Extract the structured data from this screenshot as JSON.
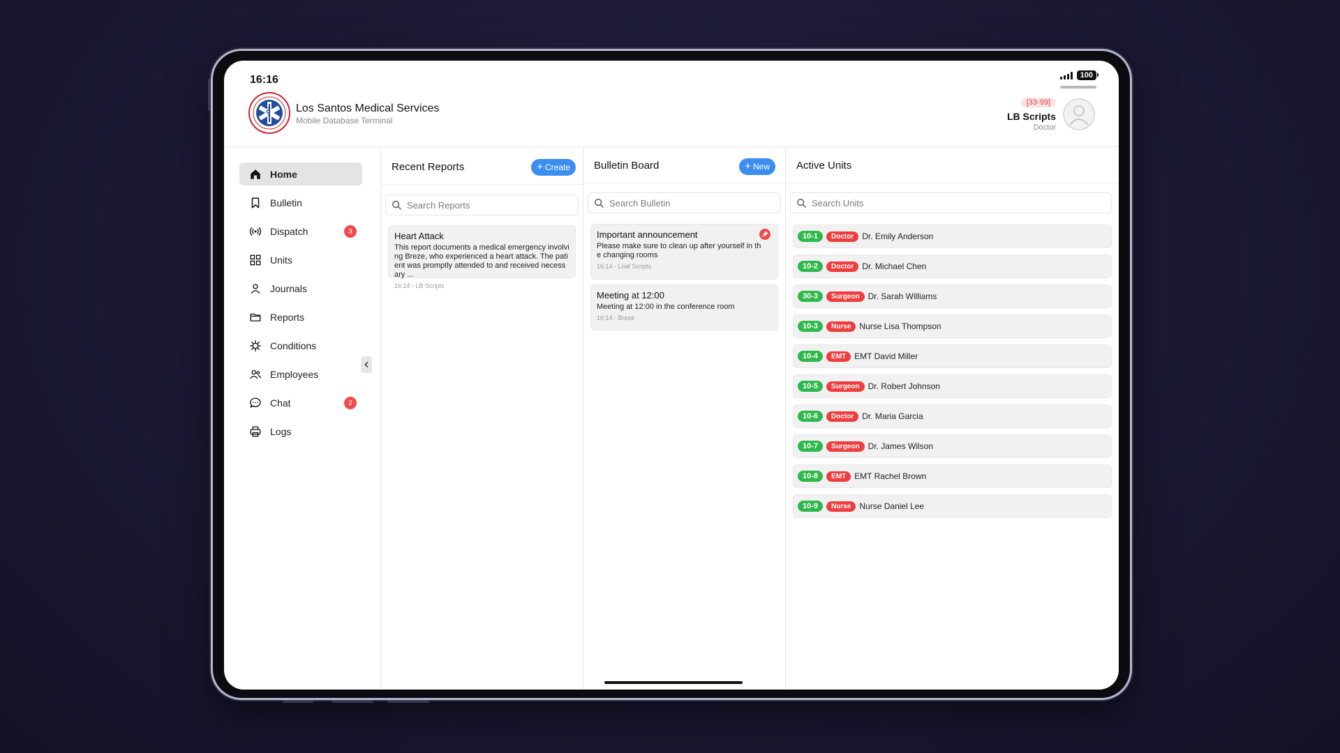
{
  "status": {
    "time": "16:16",
    "battery": "100"
  },
  "header": {
    "org_name": "Los Santos Medical Services",
    "org_sub": "Mobile Database Terminal",
    "user_id": "[33-99]",
    "user_name": "LB Scripts",
    "user_role": "Doctor"
  },
  "sidebar": {
    "items": [
      {
        "label": "Home",
        "icon": "home-icon"
      },
      {
        "label": "Bulletin",
        "icon": "bookmark-icon"
      },
      {
        "label": "Dispatch",
        "icon": "broadcast-icon",
        "badge": "3"
      },
      {
        "label": "Units",
        "icon": "grid-icon"
      },
      {
        "label": "Journals",
        "icon": "user-icon"
      },
      {
        "label": "Reports",
        "icon": "folder-icon"
      },
      {
        "label": "Conditions",
        "icon": "virus-icon"
      },
      {
        "label": "Employees",
        "icon": "users-icon"
      },
      {
        "label": "Chat",
        "icon": "chat-icon",
        "badge": "2"
      },
      {
        "label": "Logs",
        "icon": "printer-icon"
      }
    ]
  },
  "reports": {
    "title": "Recent Reports",
    "create_label": "Create",
    "search_placeholder": "Search Reports",
    "items": [
      {
        "title": "Heart Attack",
        "body": "This report documents a medical emergency involving Breze, who experienced a heart attack. The patient was promptly attended to and received necessary ...",
        "meta": "16:14 - LB Scripts"
      }
    ]
  },
  "bulletin": {
    "title": "Bulletin Board",
    "new_label": "New",
    "search_placeholder": "Search Bulletin",
    "items": [
      {
        "title": "Important announcement",
        "body": "Please make sure to clean up after yourself in the changing rooms",
        "meta": "16:14 - Loaf Scripts"
      },
      {
        "title": "Meeting at 12:00",
        "body": "Meeting at 12:00 in the conference room",
        "meta": "16:14 - Breze"
      }
    ]
  },
  "units": {
    "title": "Active Units",
    "search_placeholder": "Search Units",
    "items": [
      {
        "code": "10-1",
        "role": "Doctor",
        "name": "Dr. Emily Anderson"
      },
      {
        "code": "10-2",
        "role": "Doctor",
        "name": "Dr. Michael Chen"
      },
      {
        "code": "30-3",
        "role": "Surgeon",
        "name": "Dr. Sarah Williams"
      },
      {
        "code": "10-3",
        "role": "Nurse",
        "name": "Nurse Lisa Thompson"
      },
      {
        "code": "10-4",
        "role": "EMT",
        "name": "EMT David Miller"
      },
      {
        "code": "10-5",
        "role": "Surgeon",
        "name": "Dr. Robert Johnson"
      },
      {
        "code": "10-6",
        "role": "Doctor",
        "name": "Dr. Maria Garcia"
      },
      {
        "code": "10-7",
        "role": "Surgeon",
        "name": "Dr. James Wilson"
      },
      {
        "code": "10-8",
        "role": "EMT",
        "name": "EMT Rachel Brown"
      },
      {
        "code": "10-9",
        "role": "Nurse",
        "name": "Nurse Daniel Lee"
      }
    ]
  },
  "colors": {
    "accent": "#3b8ef0",
    "badge_red": "#ef4b4b",
    "unit_green": "#2fb84b",
    "role_red": "#ee3d3d"
  }
}
